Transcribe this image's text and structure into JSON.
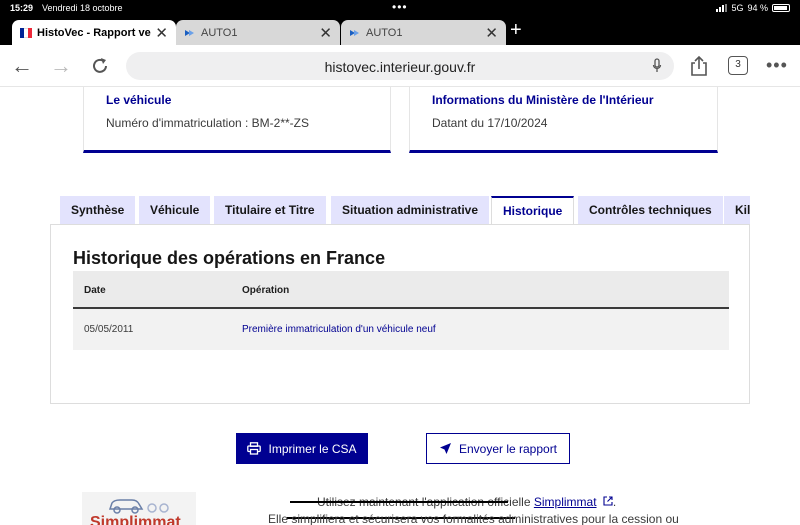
{
  "status_bar": {
    "time": "15:29",
    "date": "Vendredi 18 octobre",
    "network": "5G",
    "battery": "94 %"
  },
  "browser": {
    "tabs": [
      {
        "title": "HistoVec - Rapport vend",
        "active": true,
        "favicon": "french-flag-icon"
      },
      {
        "title": "AUTO1",
        "active": false,
        "favicon": "auto1-icon"
      },
      {
        "title": "AUTO1",
        "active": false,
        "favicon": "auto1-icon"
      }
    ],
    "url": "histovec.interieur.gouv.fr",
    "tab_count": "3"
  },
  "cards": {
    "vehicle": {
      "title": "Le véhicule",
      "text": "Numéro d'immatriculation : BM-2**-ZS"
    },
    "ministry": {
      "title": "Informations du Ministère de l'Intérieur",
      "text": "Datant du 17/10/2024"
    }
  },
  "page_tabs": [
    "Synthèse",
    "Véhicule",
    "Titulaire et Titre",
    "Situation administrative",
    "Historique",
    "Contrôles techniques",
    "Kil"
  ],
  "active_tab": "Historique",
  "history": {
    "title": "Historique des opérations en France",
    "columns": [
      "Date",
      "Opération"
    ],
    "rows": [
      {
        "date": "05/05/2011",
        "operation": "Première immatriculation d'un véhicule neuf"
      }
    ]
  },
  "actions": {
    "print": "Imprimer le CSA",
    "send": "Envoyer le rapport"
  },
  "promo": {
    "logo_text": "Simplimmat",
    "line1_prefix": "Utilisez maintenant l'application officielle",
    "line1_link": "Simplimmat",
    "line1_suffix": ".",
    "line2": "Elle simplifiera et sécurisera vos formalités administratives pour la cession ou"
  },
  "colors": {
    "brand_blue": "#000091",
    "tab_bg": "#e3e3fd"
  }
}
